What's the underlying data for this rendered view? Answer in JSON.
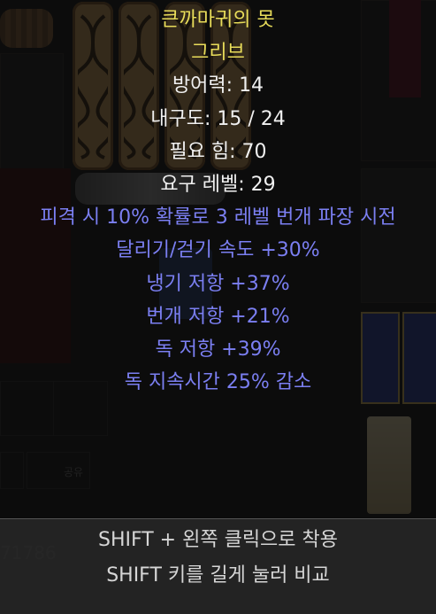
{
  "item": {
    "name": "큰까마귀의 못",
    "type": "그리브",
    "stats": [
      {
        "text": "방어력: 14",
        "color": "white"
      },
      {
        "text": "내구도: 15 / 24",
        "color": "white"
      },
      {
        "text": "필요 힘: 70",
        "color": "white"
      },
      {
        "text": "요구 레벨: 29",
        "color": "white"
      }
    ],
    "affixes": [
      "피격 시 10% 확률로 3 레벨 번개 파장 시전",
      "달리기/걷기 속도 +30%",
      "냉기 저항 +37%",
      "번개 저항 +21%",
      "독 저항 +39%",
      "독 지속시간 25% 감소"
    ]
  },
  "footer": {
    "equip_hint": "SHIFT + 왼쪽 클릭으로 착용",
    "compare_hint": "SHIFT 키를 길게 눌러 비교"
  },
  "background": {
    "gold_amount": "71786",
    "shared_label": "공유"
  },
  "colors": {
    "unique_name": "#e8dc5a",
    "base_stat": "#f0f0f0",
    "magic_affix": "#7b7ff2"
  }
}
